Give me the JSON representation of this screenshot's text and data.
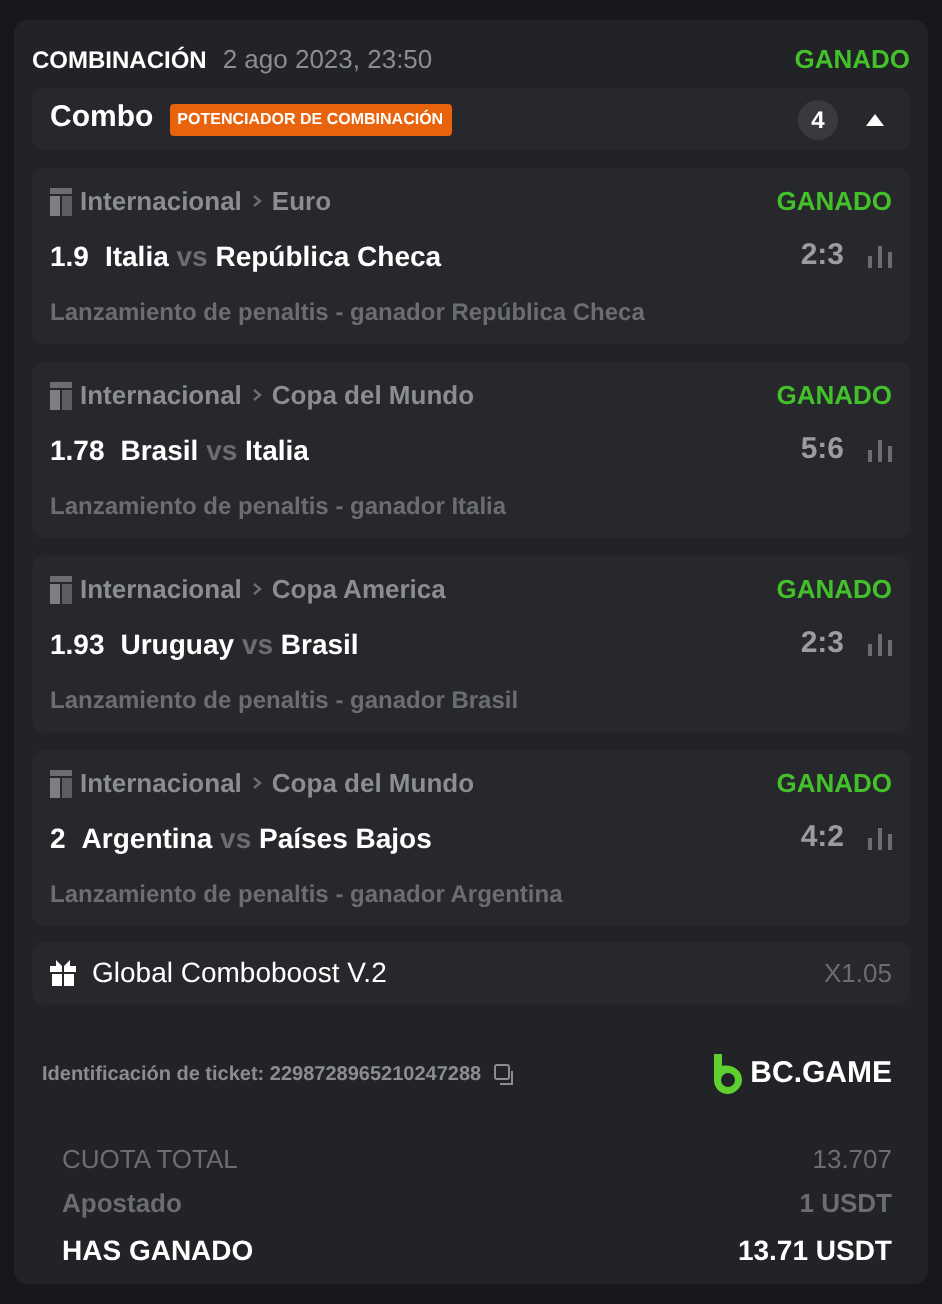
{
  "header": {
    "title": "COMBINACIÓN",
    "date": "2 ago 2023, 23:50",
    "status": "GANADO"
  },
  "combo": {
    "label": "Combo",
    "badge": "POTENCIADOR DE COMBINACIÓN",
    "count": "4",
    "expanded": true
  },
  "selections": [
    {
      "category": "Internacional",
      "league": "Euro",
      "status": "GANADO",
      "odds": "1.9",
      "home": "Italia",
      "vs": "vs",
      "away": "República Checa",
      "score": "2:3",
      "market": "Lanzamiento de penaltis - ganador República Checa"
    },
    {
      "category": "Internacional",
      "league": "Copa del Mundo",
      "status": "GANADO",
      "odds": "1.78",
      "home": "Brasil",
      "vs": "vs",
      "away": "Italia",
      "score": "5:6",
      "market": "Lanzamiento de penaltis - ganador Italia"
    },
    {
      "category": "Internacional",
      "league": "Copa America",
      "status": "GANADO",
      "odds": "1.93",
      "home": "Uruguay",
      "vs": "vs",
      "away": "Brasil",
      "score": "2:3",
      "market": "Lanzamiento de penaltis - ganador Brasil"
    },
    {
      "category": "Internacional",
      "league": "Copa del Mundo",
      "status": "GANADO",
      "odds": "2",
      "home": "Argentina",
      "vs": "vs",
      "away": "Países Bajos",
      "score": "4:2",
      "market": "Lanzamiento de penaltis - ganador Argentina"
    }
  ],
  "boost": {
    "label": "Global Comboboost V.2",
    "multiplier": "X1.05"
  },
  "ticket": {
    "label": "Identificación de ticket: 2298728965210247288",
    "brand": "BC.GAME"
  },
  "totals": [
    {
      "kind": "muted",
      "label": "CUOTA TOTAL",
      "value": "13.707"
    },
    {
      "kind": "muted",
      "label": "Apostado",
      "value": "1 USDT"
    },
    {
      "kind": "strong",
      "label": "HAS GANADO",
      "value": "13.71 USDT"
    }
  ]
}
